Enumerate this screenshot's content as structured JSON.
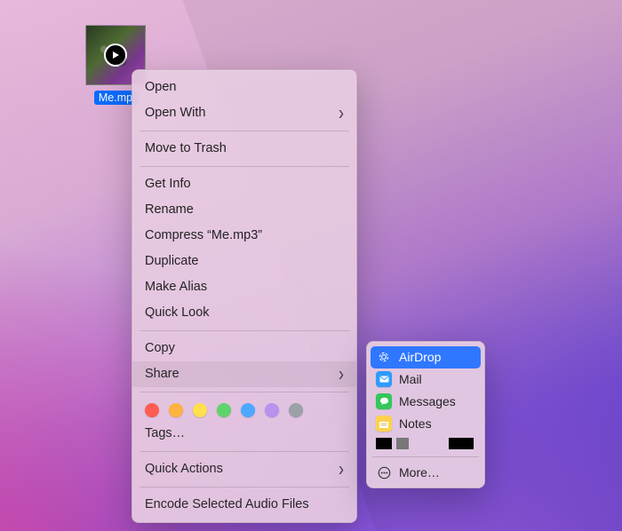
{
  "file": {
    "name_truncated": "Me.mp"
  },
  "context_menu": {
    "open": "Open",
    "open_with": "Open With",
    "move_to_trash": "Move to Trash",
    "get_info": "Get Info",
    "rename": "Rename",
    "compress": "Compress “Me.mp3”",
    "duplicate": "Duplicate",
    "make_alias": "Make Alias",
    "quick_look": "Quick Look",
    "copy": "Copy",
    "share": "Share",
    "tags": "Tags…",
    "quick_actions": "Quick Actions",
    "encode": "Encode Selected Audio Files"
  },
  "tag_colors": [
    "#ff5a50",
    "#ffb23d",
    "#ffe04a",
    "#5dd36a",
    "#4aa8ff",
    "#b990ef",
    "#9aa0a6"
  ],
  "share_submenu": {
    "airdrop": "AirDrop",
    "mail": "Mail",
    "messages": "Messages",
    "notes": "Notes",
    "more": "More…"
  },
  "icon_colors": {
    "airdrop": "#2f77ff",
    "mail": "#2e9cff",
    "messages": "#34c759",
    "notes": "#ffd24a"
  }
}
